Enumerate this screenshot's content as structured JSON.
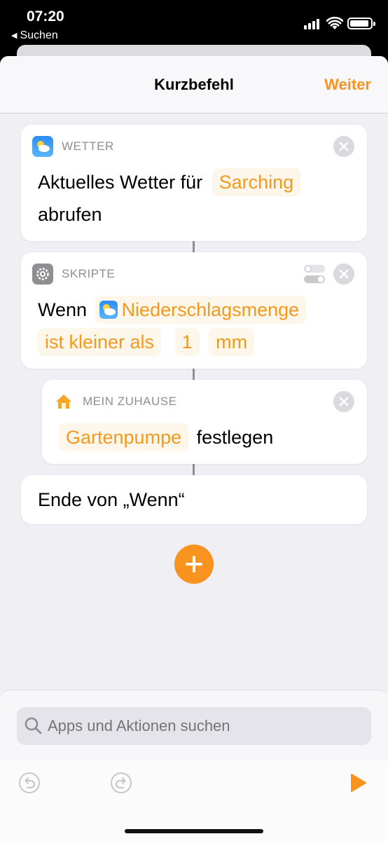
{
  "status_bar": {
    "time": "07:20",
    "back_label": "Suchen"
  },
  "nav": {
    "title": "Kurzbefehl",
    "next_label": "Weiter"
  },
  "actions": [
    {
      "category": "WETTER",
      "icon": "weather-app-icon",
      "text_before": "Aktuelles Wetter für",
      "location_token": "Sarching",
      "text_after": "abrufen"
    },
    {
      "category": "SKRIPTE",
      "icon": "scripts-gear-icon",
      "if_label": "Wenn",
      "variable_token": "Niederschlagsmenge",
      "condition_token": "ist kleiner als",
      "value_token": "1",
      "unit_token": "mm"
    },
    {
      "category": "MEIN ZUHAUSE",
      "icon": "home-app-icon",
      "accessory_token": "Gartenpumpe",
      "text_after": "festlegen"
    },
    {
      "end_label": "Ende von „Wenn“"
    }
  ],
  "search": {
    "placeholder": "Apps und Aktionen suchen"
  },
  "colors": {
    "accent": "#f7931e",
    "token_bg": "#fdf6ea",
    "sheet_bg": "#f0eff4"
  }
}
